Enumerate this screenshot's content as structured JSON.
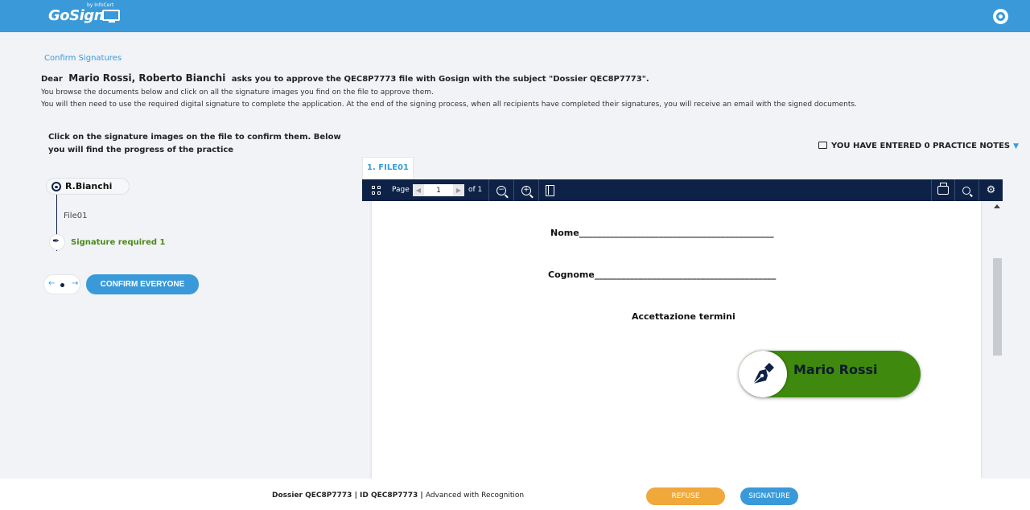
{
  "app": {
    "logo_text": "GoSign",
    "logo_small": "by InfoCert"
  },
  "breadcrumb": "Confirm Signatures",
  "intro": {
    "dear": "Dear",
    "names": "Mario Rossi, Roberto Bianchi",
    "request": "asks you to approve the QEC8P7773 file with Gosign with the subject \"Dossier QEC8P7773\".",
    "line1": "You browse the documents below and click on all the signature images you find on the file to approve them.",
    "line2": "You will then need to use the required digital signature to complete the application. At the end of the signing process, when all recipients have completed their signatures, you will receive an email with the signed documents."
  },
  "left_panel": {
    "instructions": "Click on the signature images on the file to confirm them. Below you will find the progress of the practice",
    "signer_name": "R.Bianchi",
    "file_name": "File01",
    "signature_required": "Signature required 1",
    "nav_prev": "←",
    "nav_next": "→",
    "confirm_everyone": "CONFIRM EVERYONE"
  },
  "notes": {
    "label": "YOU HAVE ENTERED 0 PRACTICE NOTES"
  },
  "viewer": {
    "tab_label": "1. FILE01",
    "page_label": "Page",
    "page_value": "1",
    "page_of": "of 1",
    "zoom_out": "−",
    "zoom_in": "+"
  },
  "document": {
    "field_nome": "Nome____________________________________________",
    "field_cognome": "Cognome_________________________________________",
    "field_terms": "Accettazione termini",
    "signature_name": "Mario Rossi"
  },
  "footer": {
    "dossier": "Dossier QEC8P7773",
    "separator1": " | ",
    "id": "ID QEC8P7773",
    "separator2": " | ",
    "type": "Advanced with Recognition",
    "refuse": "REFUSE",
    "sign": "SIGNATURE"
  },
  "colors": {
    "brand_blue": "#3a9ad9",
    "toolbar_navy": "#0d2246",
    "signature_green": "#3f8a0e",
    "refuse_orange": "#f0a83a"
  }
}
